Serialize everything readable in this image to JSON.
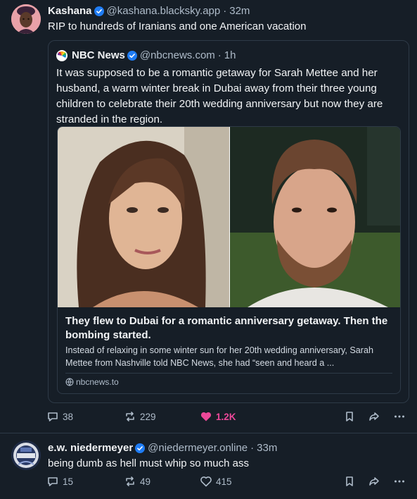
{
  "posts": [
    {
      "author": {
        "name": "Kashana",
        "handle": "@kashana.blacksky.app",
        "time": "32m"
      },
      "text": "RIP to hundreds of Iranians and one American vacation",
      "quote": {
        "author": {
          "name": "NBC News",
          "handle": "@nbcnews.com",
          "time": "1h"
        },
        "text": "It was supposed to be a romantic getaway for Sarah Mettee and her husband, a warm winter break in Dubai away from their three young children to celebrate their 20th wedding anniversary but now they are stranded in the region.",
        "card": {
          "title": "They flew to Dubai for a romantic anniversary getaway. Then the bombing started.",
          "description": "Instead of relaxing in some winter sun for her 20th wedding anniversary, Sarah Mettee from Nashville told NBC News, she had “seen and heard a ...",
          "domain": "nbcnews.to"
        }
      },
      "counts": {
        "replies": "38",
        "reposts": "229",
        "likes": "1.2K"
      },
      "liked": true
    },
    {
      "author": {
        "name": "e.w. niedermeyer",
        "handle": "@niedermeyer.online",
        "time": "33m"
      },
      "text": "being dumb as hell must whip so much ass",
      "counts": {
        "replies": "15",
        "reposts": "49",
        "likes": "415"
      },
      "liked": false
    }
  ],
  "colors": {
    "background": "#161e27",
    "border": "#2e3a47",
    "muted_text": "#aebbc9",
    "verified": "#1f7cf4",
    "like_active": "#ec4899"
  },
  "icons": [
    "verified-badge-icon",
    "reply-icon",
    "repost-icon",
    "heart-icon",
    "bookmark-icon",
    "share-icon",
    "more-icon",
    "globe-icon"
  ]
}
